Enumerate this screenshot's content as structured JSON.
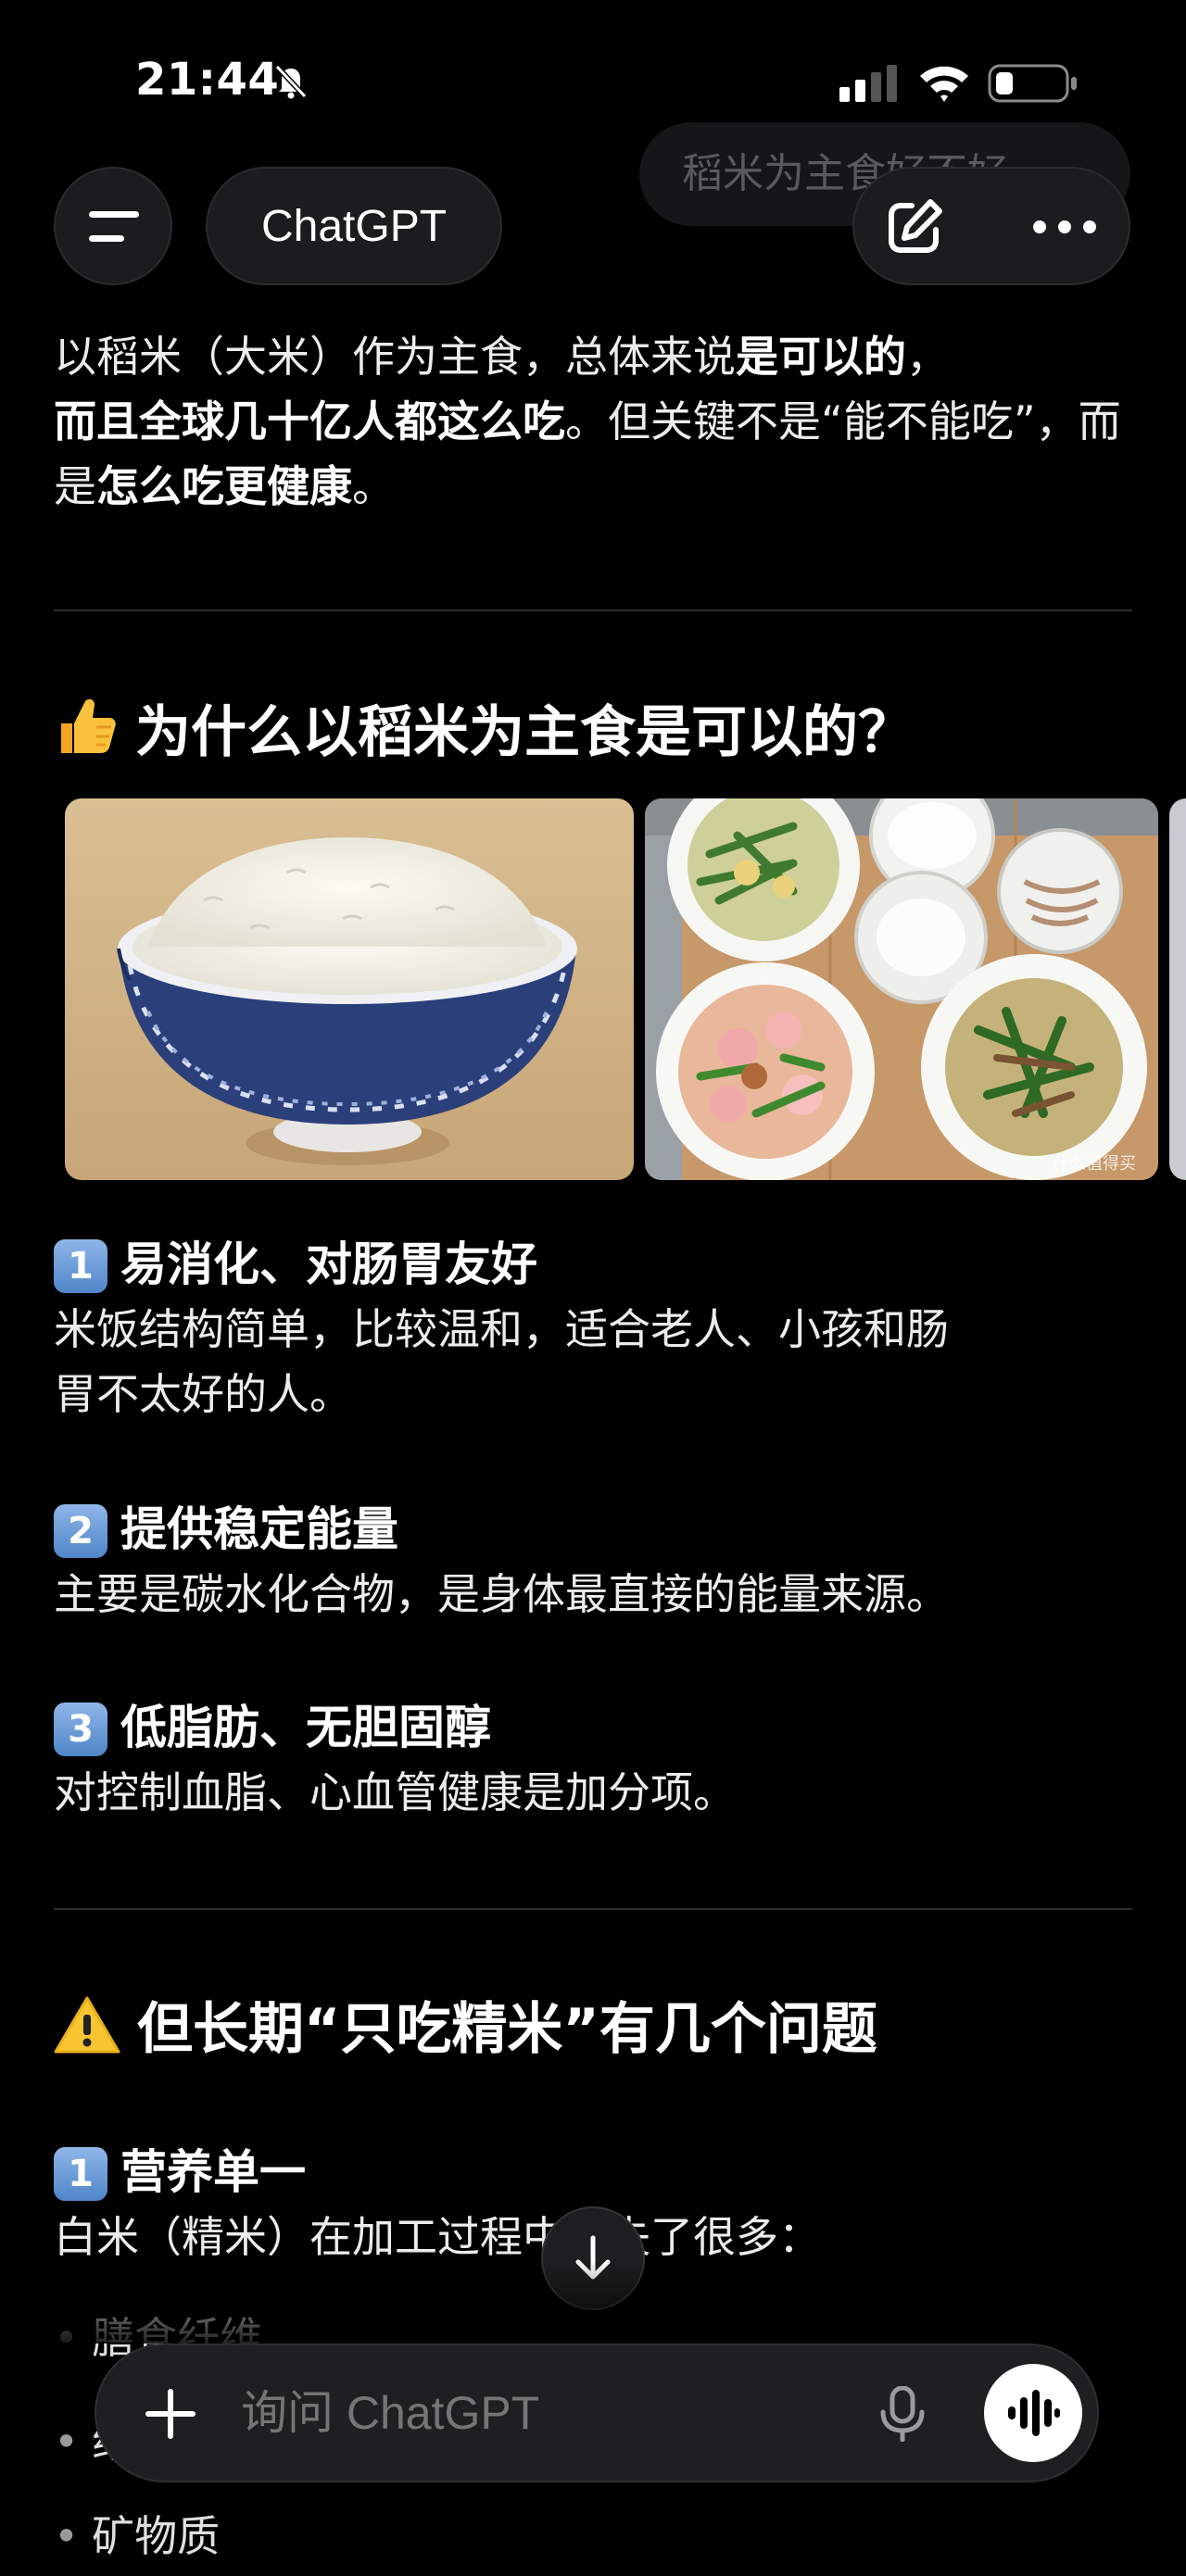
{
  "status_bar": {
    "time": "21:44",
    "icons": [
      "bell-off-icon",
      "signal-icon",
      "wifi-icon",
      "battery-icon"
    ]
  },
  "header": {
    "menu_icon": "hamburger-icon",
    "app_title": "ChatGPT",
    "ghost_title": "稻米为主食好不好",
    "new_chat_icon": "new-chat-icon",
    "more_icon": "more-icon"
  },
  "message": {
    "intro": {
      "p1": "以稻米（大米）作为主食，总体来说",
      "p1_bold": "是可以的",
      "p2": "，",
      "p3_bold": "而且全球几十亿人都这么吃",
      "p4": "。但关键不是“能不能吃”，而是",
      "p5_bold": "怎么吃更健康",
      "p6": "。"
    },
    "section1": {
      "icon": "thumbs-up-icon",
      "title": "为什么以稻米为主食是可以的？",
      "images": [
        "bowl-of-rice-image",
        "rice-with-dishes-image"
      ],
      "image_watermark": "什么值得买",
      "points": [
        {
          "num": "1",
          "title": "易消化、对肠胃友好",
          "body_1": "米饭结构简单，比较温和，适合老人、小孩和肠",
          "body_2": "胃不太好的人。"
        },
        {
          "num": "2",
          "title": "提供稳定能量",
          "body_1": "主要是碳水化合物，是身体最直接的能量来源。",
          "body_2": ""
        },
        {
          "num": "3",
          "title": "低脂肪、无胆固醇",
          "body_1": "对控制血脂、心血管健康是加分项。",
          "body_2": ""
        }
      ]
    },
    "section2": {
      "icon": "warning-icon",
      "title": "但长期“只吃精米”有几个问题",
      "points": [
        {
          "num": "1",
          "title": "营养单一",
          "body_1": "白米（精米）在加工过程中丢失了很多："
        }
      ],
      "bullets": [
        "膳食纤维",
        "维生素",
        "矿物质"
      ]
    }
  },
  "composer": {
    "plus_icon": "plus-icon",
    "placeholder": "询问 ChatGPT",
    "mic_icon": "mic-icon",
    "voice_icon": "voice-mode-icon"
  },
  "colors": {
    "background": "#000000",
    "surface": "#1c1c1e",
    "text": "#ececec",
    "muted": "#8e8e93",
    "keycap": "#4f86c9"
  }
}
